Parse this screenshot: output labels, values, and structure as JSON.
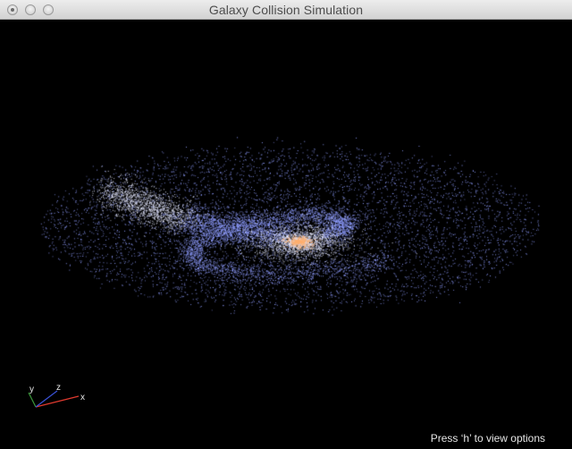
{
  "window": {
    "title": "Galaxy Collision Simulation"
  },
  "axes": {
    "x_label": "x",
    "y_label": "y",
    "z_label": "z",
    "colors": {
      "x": "#e03a2f",
      "y": "#3b9a3b",
      "z": "#3a52d8"
    }
  },
  "hint": "Press ‘h’ to view options",
  "colors": {
    "background": "#000000",
    "particles": "#8f9dff",
    "particles_bright": "#e6e9ff",
    "core": "#ffb070"
  }
}
